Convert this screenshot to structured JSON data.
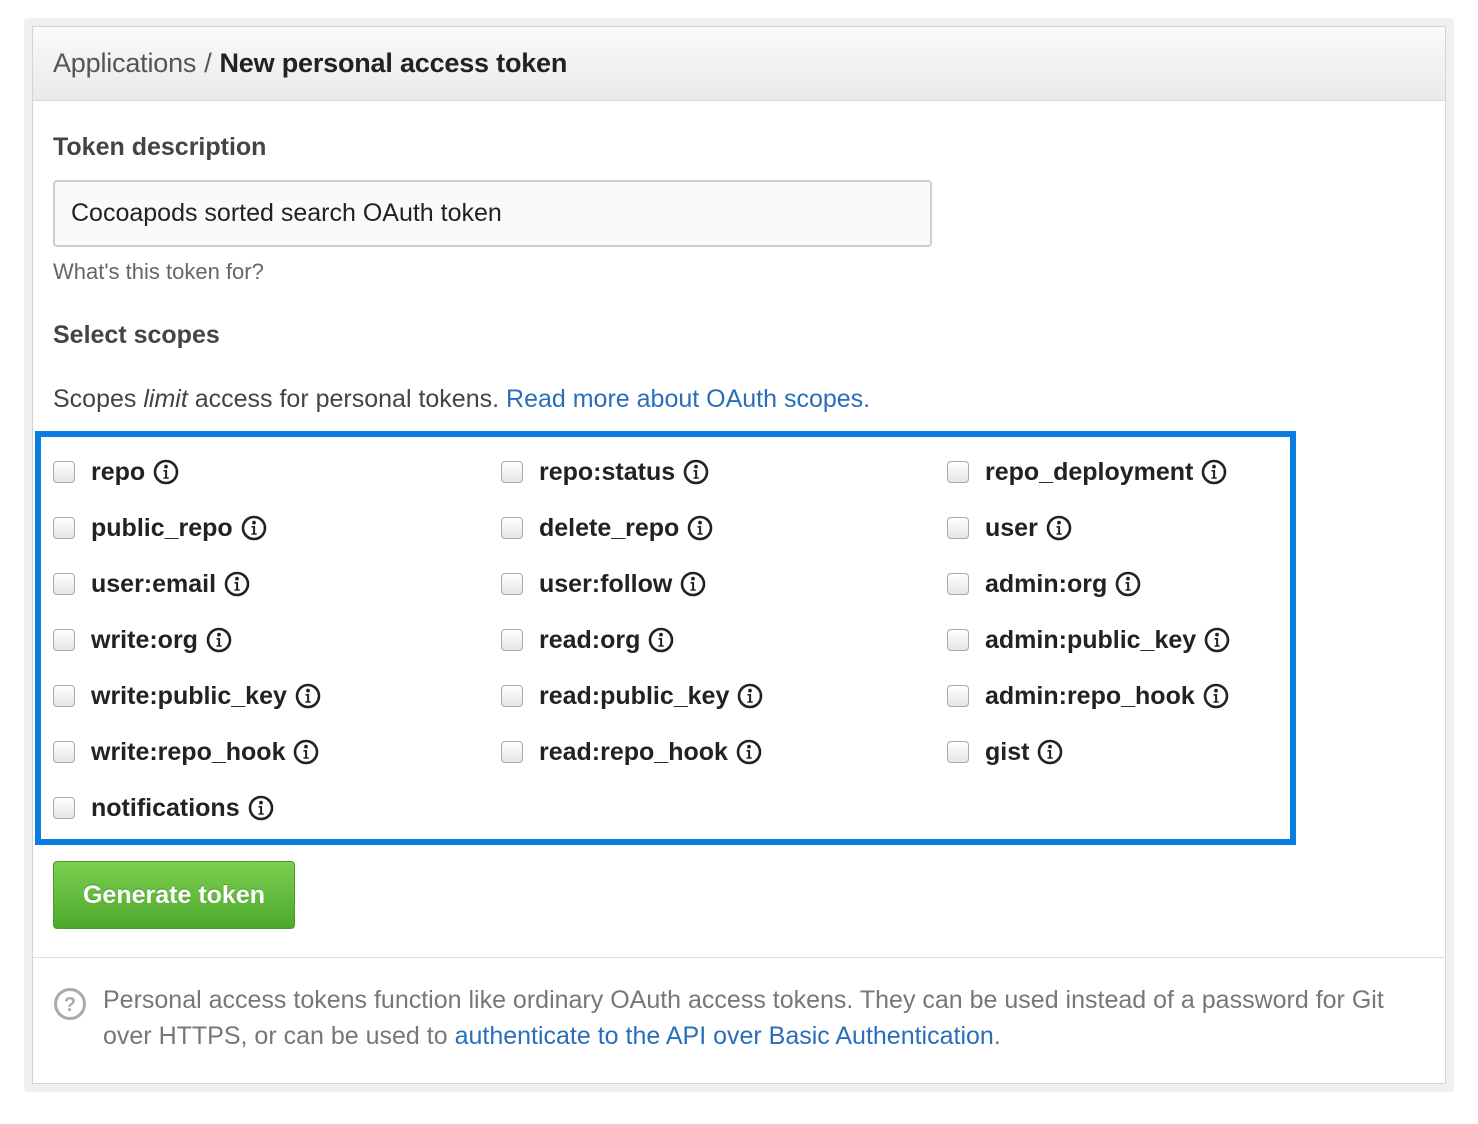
{
  "header": {
    "breadcrumb_parent": "Applications",
    "separator": "/",
    "title": "New personal access token"
  },
  "token": {
    "label": "Token description",
    "value": "Cocoapods sorted search OAuth token",
    "note": "What's this token for?"
  },
  "scopes": {
    "heading": "Select scopes",
    "desc_prefix": "Scopes",
    "desc_limit": "limit",
    "desc_suffix": "access for personal tokens.",
    "read_more_link": "Read more about OAuth scopes.",
    "items": [
      {
        "name": "repo",
        "checked": false
      },
      {
        "name": "repo:status",
        "checked": false
      },
      {
        "name": "repo_deployment",
        "checked": false
      },
      {
        "name": "public_repo",
        "checked": false
      },
      {
        "name": "delete_repo",
        "checked": false
      },
      {
        "name": "user",
        "checked": false
      },
      {
        "name": "user:email",
        "checked": false
      },
      {
        "name": "user:follow",
        "checked": false
      },
      {
        "name": "admin:org",
        "checked": false
      },
      {
        "name": "write:org",
        "checked": false
      },
      {
        "name": "read:org",
        "checked": false
      },
      {
        "name": "admin:public_key",
        "checked": false
      },
      {
        "name": "write:public_key",
        "checked": false
      },
      {
        "name": "read:public_key",
        "checked": false
      },
      {
        "name": "admin:repo_hook",
        "checked": false
      },
      {
        "name": "write:repo_hook",
        "checked": false
      },
      {
        "name": "read:repo_hook",
        "checked": false
      },
      {
        "name": "gist",
        "checked": false
      },
      {
        "name": "notifications",
        "checked": false
      }
    ]
  },
  "actions": {
    "generate_label": "Generate token"
  },
  "footer": {
    "text_prefix": "Personal access tokens function like ordinary OAuth access tokens. They can be used instead of a password for Git over HTTPS, or can be used to",
    "link": "authenticate to the API over Basic Authentication",
    "text_suffix": "."
  },
  "colors": {
    "highlight_border": "#0a7ee0",
    "link": "#2a6ebb",
    "button_green": "#5cb83a"
  },
  "icons": [
    "info-icon",
    "help-icon"
  ]
}
